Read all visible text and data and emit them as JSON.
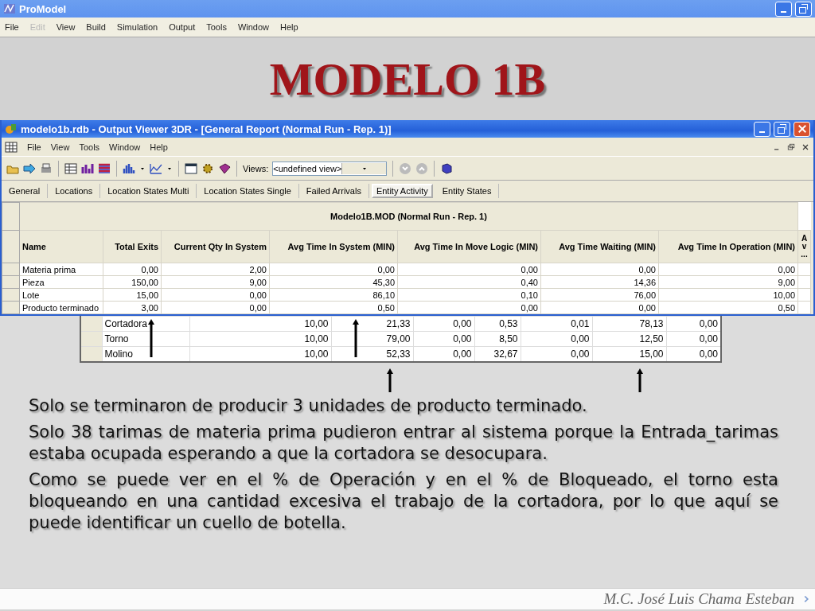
{
  "app": {
    "title": "ProModel",
    "menu": [
      {
        "label": "File",
        "disabled": false
      },
      {
        "label": "Edit",
        "disabled": true
      },
      {
        "label": "View",
        "disabled": false
      },
      {
        "label": "Build",
        "disabled": false
      },
      {
        "label": "Simulation",
        "disabled": false
      },
      {
        "label": "Output",
        "disabled": false
      },
      {
        "label": "Tools",
        "disabled": false
      },
      {
        "label": "Window",
        "disabled": false
      },
      {
        "label": "Help",
        "disabled": false
      }
    ]
  },
  "slide": {
    "title": "MODELO 1B"
  },
  "viewer": {
    "title": "modelo1b.rdb - Output Viewer 3DR - [General Report (Normal Run - Rep. 1)]",
    "menu": [
      "File",
      "View",
      "Tools",
      "Window",
      "Help"
    ],
    "views_label": "Views:",
    "views_value": "<undefined view>",
    "tabs": [
      {
        "label": "General",
        "selected": false
      },
      {
        "label": "Locations",
        "selected": false
      },
      {
        "label": "Location States Multi",
        "selected": false
      },
      {
        "label": "Location States Single",
        "selected": false
      },
      {
        "label": "Failed Arrivals",
        "selected": false
      },
      {
        "label": "Entity Activity",
        "selected": true
      },
      {
        "label": "Entity States",
        "selected": false
      }
    ],
    "table": {
      "caption": "Modelo1B.MOD (Normal Run - Rep. 1)",
      "columns": [
        "Name",
        "Total Exits",
        "Current Qty In System",
        "Avg Time In System (MIN)",
        "Avg Time In Move Logic (MIN)",
        "Avg Time Waiting (MIN)",
        "Avg Time In Operation (MIN)",
        "A v ..."
      ],
      "rows": [
        [
          "Materia prima",
          "0,00",
          "2,00",
          "0,00",
          "0,00",
          "0,00",
          "0,00"
        ],
        [
          "Pieza",
          "150,00",
          "9,00",
          "45,30",
          "0,40",
          "14,36",
          "9,00"
        ],
        [
          "Lote",
          "15,00",
          "0,00",
          "86,10",
          "0,10",
          "76,00",
          "10,00"
        ],
        [
          "Producto terminado",
          "3,00",
          "0,00",
          "0,50",
          "0,00",
          "0,00",
          "0,50"
        ]
      ]
    }
  },
  "locations_table": {
    "rows": [
      [
        "Cortadora",
        "10,00",
        "21,33",
        "0,00",
        "0,53",
        "0,01",
        "78,13",
        "0,00"
      ],
      [
        "Torno",
        "10,00",
        "79,00",
        "0,00",
        "8,50",
        "0,00",
        "12,50",
        "0,00"
      ],
      [
        "Molino",
        "10,00",
        "52,33",
        "0,00",
        "32,67",
        "0,00",
        "15,00",
        "0,00"
      ]
    ]
  },
  "paragraphs": [
    "Solo se terminaron de producir 3 unidades de producto terminado.",
    "Solo 38 tarimas de materia prima pudieron entrar al sistema porque la Entrada_tarimas estaba ocupada esperando a que la cortadora se desocupara.",
    "Como se puede ver en el % de Operación y en el % de Bloqueado, el torno esta bloqueando en una cantidad excesiva el trabajo de la cortadora, por lo que aquí se puede identificar un cuello de botella."
  ],
  "author": "M.C. José Luis Chama Esteban"
}
